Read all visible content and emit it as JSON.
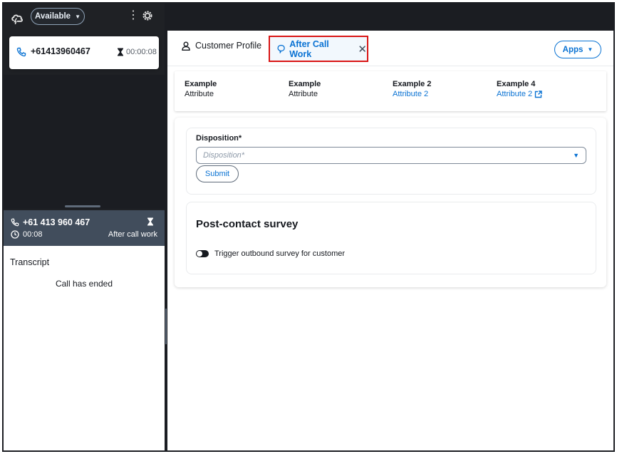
{
  "sidebar": {
    "status": "Available",
    "contact": {
      "number": "+61413960467",
      "timer": "00:00:08"
    },
    "call": {
      "number": "+61 413 960 467",
      "time": "00:08",
      "state": "After call work"
    },
    "transcript": {
      "title": "Transcript",
      "message": "Call has ended"
    }
  },
  "tabs": {
    "profile": "Customer Profile",
    "acw": "After Call Work",
    "close": "✕",
    "apps": "Apps"
  },
  "attributes": [
    {
      "key": "Example",
      "value": "Attribute"
    },
    {
      "key": "Example",
      "value": "Attribute"
    },
    {
      "key": "Example 2",
      "value": "Attribute 2"
    },
    {
      "key": "Example 4",
      "value": "Attribute 2"
    }
  ],
  "disposition": {
    "label": "Disposition*",
    "placeholder": "Disposition*",
    "submit": "Submit"
  },
  "survey": {
    "title": "Post-contact survey",
    "toggle_label": "Trigger outbound survey for customer"
  },
  "colors": {
    "accent": "#0972d3",
    "highlight": "#d91515",
    "dark_bg": "#1b1d22",
    "call_bar": "#414d5c"
  }
}
